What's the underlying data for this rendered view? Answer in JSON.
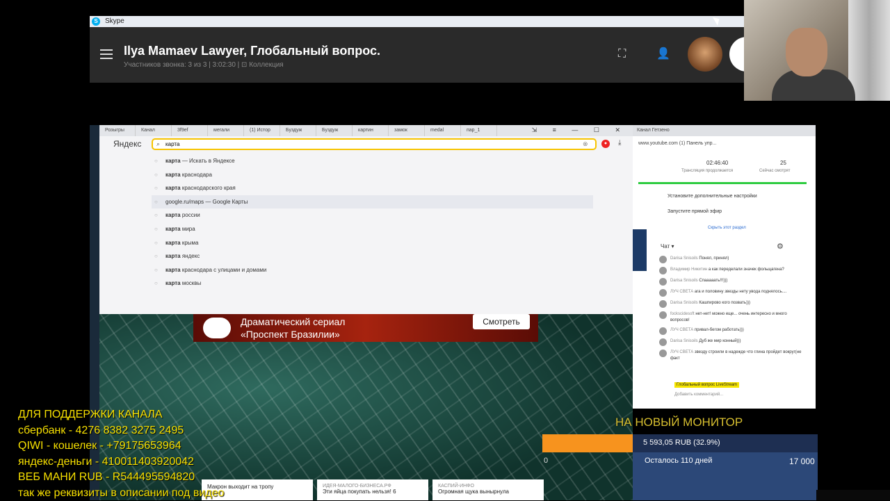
{
  "skype": {
    "window_title": "Skype",
    "logo_letter": "S",
    "call_title": "Ilya Mamaev Lawyer, Глобальный вопрос.",
    "call_subtitle": "Участников звонка: 3 из 3 | 3:02:30 | ⊡ Коллекция"
  },
  "browser": {
    "tabs": [
      "Розыгры",
      "Канал",
      "3f9ef",
      "мегали",
      "(1) Истор",
      "Буздуж",
      "Буздуж",
      "картин",
      "замок",
      "medal",
      "пар_1"
    ],
    "engine_label": "Яндекс",
    "address_value": "карта",
    "window_controls": "⇲ ≡ — ☐ ✕",
    "suggestions": [
      {
        "bold": "карта",
        "rest": " — Искать в Яндексе"
      },
      {
        "bold": "карта",
        "rest": " краснодара"
      },
      {
        "bold": "карта",
        "rest": " краснодарского края"
      },
      {
        "bold": "",
        "rest": "google.ru/maps — Google Карты"
      },
      {
        "bold": "карта",
        "rest": " россии"
      },
      {
        "bold": "карта",
        "rest": " мира"
      },
      {
        "bold": "карта",
        "rest": " крыма"
      },
      {
        "bold": "карта",
        "rest": " яндекс"
      },
      {
        "bold": "карта",
        "rest": " краснодара с улицами и домами"
      },
      {
        "bold": "карта",
        "rest": " москвы"
      }
    ],
    "selected_suggestion": 3
  },
  "ad": {
    "text": "Драматический сериал\n«Проспект Бразилии»",
    "button": "Смотреть"
  },
  "news": [
    {
      "source": "",
      "title": "Макрон выходит на тропу"
    },
    {
      "source": "ИДЕЯ-МАЛОГО-БИЗНЕСА.РФ",
      "title": "Эти яйца покупать нельзя! 6"
    },
    {
      "source": "КАСПИЙ-ИНФО",
      "title": "Огромная щука вынырнула"
    }
  ],
  "youtube": {
    "tab": "Канал   Гетзено",
    "url": "www.youtube.com  (1) Панель упр...",
    "stream_time": "02:46:40",
    "stream_time_label": "Трансляция продолжается",
    "viewers": "25",
    "viewers_label": "Сейчас смотрят",
    "options": [
      "Установите дополнительные настройки",
      "Запустите прямой эфир"
    ],
    "hide_link": "Скрыть этот раздел",
    "chat_label": "Чат ▾",
    "messages": [
      {
        "name": "Darisa Snisoils",
        "text": "Понял, принял)"
      },
      {
        "name": "Владимир Никитин",
        "text": "а как переделали значек фольщагена?"
      },
      {
        "name": "Darisa Snisoils",
        "text": "Спааааать!!!)))"
      },
      {
        "name": "ЛУЧ СВЕТА",
        "text": "ага и половину звезды нету увода поднялось...."
      },
      {
        "name": "Darisa Snisoils",
        "text": "Кашпирово кого позвать)))"
      },
      {
        "name": "fockscidesoft",
        "text": "нет-нет! можно еще... очень интересно и много вопросов!"
      },
      {
        "name": "ЛУЧ СВЕТА",
        "text": "привал-бегом работать)))"
      },
      {
        "name": "Darisa Snisoils",
        "text": "Дуб же мир конный)))"
      },
      {
        "name": "ЛУЧ СВЕТА",
        "text": "звезду строили в надежде что глина пройдет вокруг(не факт"
      }
    ],
    "live_badge": "Глобальный вопрос LiveStream",
    "chat_placeholder": "Добавить комментарий..."
  },
  "goal": {
    "title": "НА НОВЫЙ МОНИТОР",
    "amount": "5 593,05 RUB (32.9%)",
    "progress": 0.329,
    "days_left": "Осталось 110 дней",
    "total": "17 000",
    "start": "0"
  },
  "support": {
    "lines": [
      "ДЛЯ  ПОДДЕРЖКИ  КАНАЛА",
      "сбербанк -  4276 8382 3275 2495",
      "QIWI - кошелек -  +79175653964",
      "яндекс-деньги - 410011403920042",
      "ВЕБ МАНИ RUB  - R544495594820",
      "так же реквизиты в описании под видео"
    ]
  },
  "colors": {
    "accent_yellow": "#f7c400",
    "support_text": "#f7e000",
    "goal_orange": "#f7931e"
  }
}
